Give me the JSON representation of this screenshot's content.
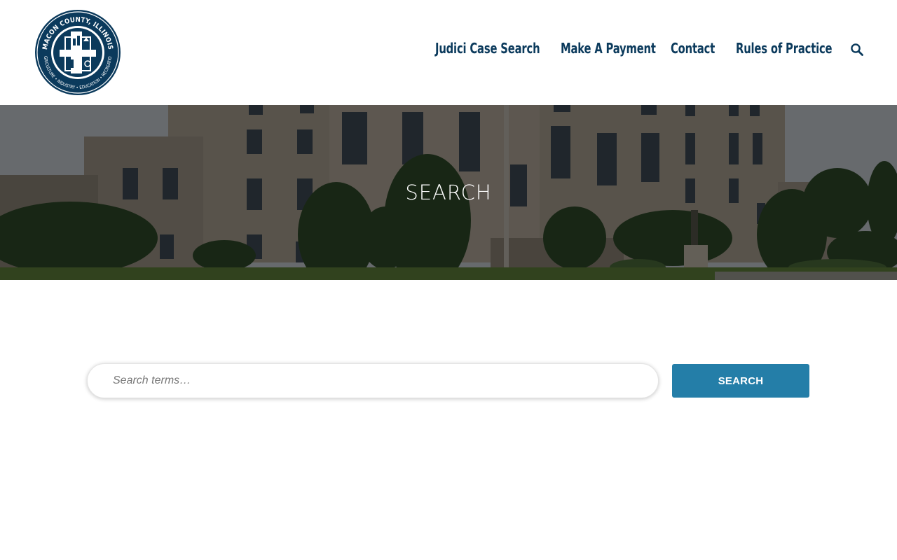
{
  "header": {
    "logo": {
      "ring_top_text": "MACON COUNTY, ILLINOIS",
      "ring_bottom_text": "AGRICULTURE • INDUSTRY • EDUCATION • RECREATION",
      "inner_text": "LINCOLN COUNTRY"
    },
    "nav": [
      {
        "label": "Judici Case Search"
      },
      {
        "label": "Make A Payment"
      },
      {
        "label": "Contact"
      },
      {
        "label": "Rules of Practice"
      }
    ],
    "search_icon": "search-icon"
  },
  "hero": {
    "title": "SEARCH"
  },
  "search_form": {
    "placeholder": "Search terms…",
    "value": "",
    "button_label": "SEARCH"
  },
  "colors": {
    "brand_navy": "#0b3a5c",
    "button_blue": "#247ea8"
  }
}
